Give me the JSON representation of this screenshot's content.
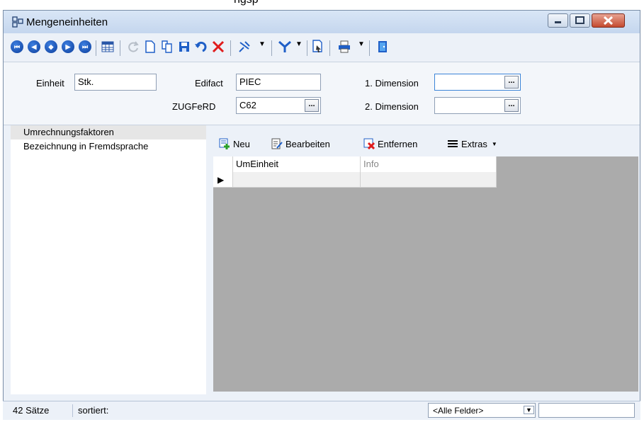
{
  "window": {
    "title": "Mengeneinheiten",
    "caption_fragment": "ngsp",
    "icons": [
      "app-window-icon",
      "minimize-icon",
      "maximize-icon",
      "close-icon"
    ]
  },
  "toolbar": {
    "buttons": [
      "first-record-icon",
      "previous-record-icon",
      "center-record-icon",
      "next-record-icon",
      "last-record-icon",
      "table-view-icon",
      "refresh-icon",
      "new-document-icon",
      "copy-icon",
      "save-icon",
      "undo-icon",
      "delete-icon",
      "pin-icon",
      "filter-icon",
      "export-icon",
      "print-icon",
      "exit-icon"
    ]
  },
  "form": {
    "einheit_label": "Einheit",
    "einheit_value": "Stk.",
    "edifact_label": "Edifact",
    "edifact_value": "PIEC",
    "zugferd_label": "ZUGFeRD",
    "zugferd_value": "C62",
    "dim1_label": "1. Dimension",
    "dim1_value": "",
    "dim2_label": "2. Dimension",
    "dim2_value": "",
    "ellipsis": "..."
  },
  "nav": {
    "items": [
      {
        "label": "Umrechnungsfaktoren",
        "selected": true
      },
      {
        "label": "Bezeichnung in Fremdsprache",
        "selected": false
      }
    ]
  },
  "subtoolbar": {
    "new_label": "Neu",
    "edit_label": "Bearbeiten",
    "remove_label": "Entfernen",
    "extras_label": "Extras"
  },
  "grid": {
    "columns": [
      "UmEinheit",
      "Info"
    ],
    "row_marker": "▶"
  },
  "status": {
    "count": "42 Sätze",
    "sorted_label": "sortiert:",
    "field_filter": "<Alle Felder>",
    "search_value": ""
  },
  "colors": {
    "accent": "#1f5fc7",
    "close_red": "#c44a2f",
    "grid_bg": "#ababab"
  }
}
